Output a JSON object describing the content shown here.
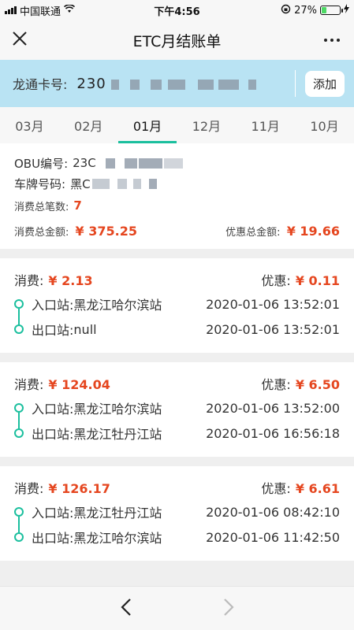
{
  "status": {
    "carrier": "中国联通",
    "time": "下午4:56",
    "battery": "27%",
    "battery_level": 0.27
  },
  "nav": {
    "title": "ETC月结账单"
  },
  "card": {
    "label": "龙通卡号:",
    "number_prefix": "230",
    "add_label": "添加"
  },
  "tabs": [
    "03月",
    "02月",
    "01月",
    "12月",
    "11月",
    "10月"
  ],
  "summary": {
    "obu_label": "OBU编号:",
    "obu_prefix": "23C",
    "plate_label": "车牌号码:",
    "plate_prefix": "黑C",
    "count_label": "消费总笔数:",
    "count_value": "7",
    "total_label": "消费总金额:",
    "total_value": "¥ 375.25",
    "discount_label": "优惠总金额:",
    "discount_value": "¥ 19.66"
  },
  "records": [
    {
      "fee_label": "消费:",
      "fee": "¥ 2.13",
      "discount_label": "优惠:",
      "discount": "¥ 0.11",
      "entry_label": "入口站:",
      "entry_station": "黑龙江哈尔滨站",
      "entry_time": "2020-01-06 13:52:01",
      "exit_label": "出口站:",
      "exit_station": "null",
      "exit_time": "2020-01-06 13:52:01"
    },
    {
      "fee_label": "消费:",
      "fee": "¥ 124.04",
      "discount_label": "优惠:",
      "discount": "¥ 6.50",
      "entry_label": "入口站:",
      "entry_station": "黑龙江哈尔滨站",
      "entry_time": "2020-01-06 13:52:00",
      "exit_label": "出口站:",
      "exit_station": "黑龙江牡丹江站",
      "exit_time": "2020-01-06 16:56:18"
    },
    {
      "fee_label": "消费:",
      "fee": "¥ 126.17",
      "discount_label": "优惠:",
      "discount": "¥ 6.61",
      "entry_label": "入口站:",
      "entry_station": "黑龙江牡丹江站",
      "entry_time": "2020-01-06 08:42:10",
      "exit_label": "出口站:",
      "exit_station": "黑龙江哈尔滨站",
      "exit_time": "2020-01-06 11:42:50"
    }
  ],
  "colors": {
    "accent": "#1bbf9e",
    "amount": "#e5461f",
    "card_bg": "#b9e3f3"
  }
}
